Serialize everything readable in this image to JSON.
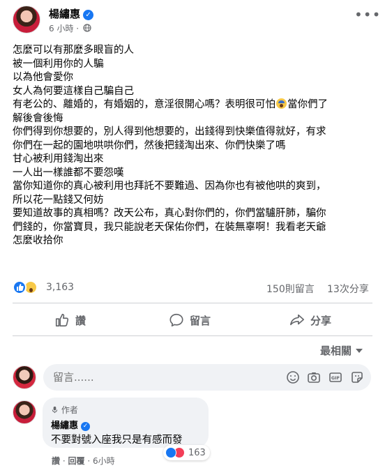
{
  "post": {
    "author": "楊繡惠",
    "time": "6 小時",
    "separator": "·",
    "body_lines": [
      "怎麼可以有那麼多眼盲的人",
      "被一個利用你的人騙",
      "以為他會愛你",
      "女人為何要這樣自己騙自己",
      "有老公的、離婚的，有婚姻的，意淫很開心嗎？表明很可怕",
      "當你們了",
      "解後會後悔",
      "你們得到你想要的，別人得到他想要的，出錢得到快樂值得就好，有求",
      "你們在一起的園地哄哄你們，然後把錢淘出來、你們快樂了嗎",
      "甘心被利用錢淘出來",
      "一人出一樣誰都不要怨嘆",
      "當你知道你的真心被利用也拜託不要難過、因為你也有被他哄的爽到，",
      "所以花一點錢又何妨",
      "要知道故事的真相嗎？改天公布，真心對你們的，你們當驢肝肺，騙你",
      "們錢的，你當寶貝，我只能說老天保佑你們，在裝無辜啊！我看老天爺",
      "怎麼收拾你"
    ],
    "emoji_icon": "scream-face-emoji",
    "more_icon": "ellipsis-icon",
    "privacy_icon": "globe-icon"
  },
  "stats": {
    "reactions_count": "3,163",
    "comments": "150則留言",
    "shares": "13次分享",
    "reaction_icons": [
      "like-icon",
      "wow-icon"
    ]
  },
  "actions": {
    "like": "讚",
    "comment": "留言",
    "share": "分享"
  },
  "sort": {
    "label": "最相關"
  },
  "composer": {
    "placeholder": "留言......",
    "icons": [
      "emoji-icon",
      "camera-icon",
      "gif-icon",
      "sticker-icon"
    ]
  },
  "top_comment": {
    "badge": "作者",
    "author": "楊繡惠",
    "text": "不要對號入座我只是有感而發",
    "like_action": "讚",
    "dot": "·",
    "reply_action": "回覆",
    "time": "6小時",
    "reaction_count": "163"
  },
  "colors": {
    "accent": "#1877f2",
    "secondary_text": "#65676b",
    "love": "#f33e58"
  }
}
